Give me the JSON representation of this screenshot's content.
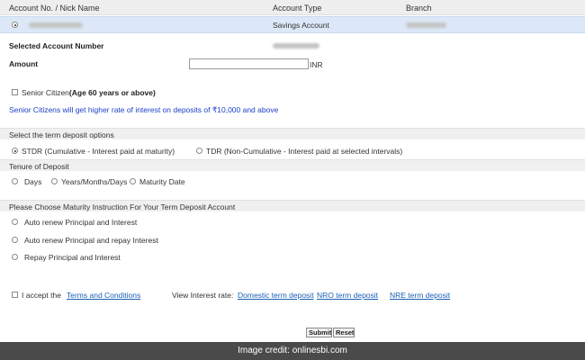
{
  "header": {
    "account_col": "Account No. / Nick Name",
    "type_col": "Account Type",
    "branch_col": "Branch"
  },
  "account_row": {
    "account_type": "Savings Account"
  },
  "selected_account_label": "Selected Account Number",
  "amount": {
    "label": "Amount",
    "value": "",
    "unit": "INR"
  },
  "senior": {
    "label_plain": "Senior Citizen",
    "label_bold": "(Age 60 years or above)",
    "note": "Senior Citizens will get higher rate of interest on deposits of ₹10,000 and above"
  },
  "term_options": {
    "title": "Select the term deposit options",
    "stdr": "STDR (Cumulative - Interest paid at maturity)",
    "tdr": "TDR (Non-Cumulative - Interest paid at selected intervals)"
  },
  "tenure": {
    "title": "Tenure of Deposit",
    "days": "Days",
    "ymd": "Years/Months/Days",
    "maturity": "Maturity Date"
  },
  "maturity": {
    "title": "Please Choose Maturity Instruction For Your Term Deposit Account",
    "opt1": "Auto renew Principal and Interest",
    "opt2": "Auto renew Principal and repay Interest",
    "opt3": "Repay Principal and Interest"
  },
  "footer": {
    "accept": "I accept the",
    "terms_link": "Terms and Conditions",
    "view_rate": "View Interest rate:",
    "domestic_link": "Domestic term deposit",
    "nro_link": "NRO term deposit",
    "nre_link": "NRE term deposit"
  },
  "buttons": {
    "submit": "Submit",
    "reset": "Reset"
  },
  "credit": "Image credit: onlinesbi.com"
}
